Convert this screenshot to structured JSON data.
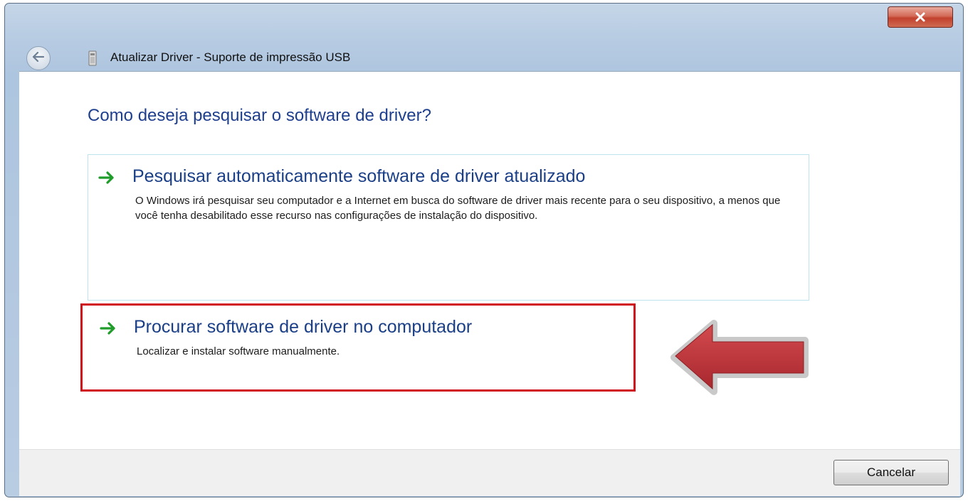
{
  "window": {
    "title": "Atualizar Driver - Suporte de impressão USB",
    "close_icon": "close-icon",
    "back_icon": "back-arrow-icon",
    "app_icon": "printer-device-icon"
  },
  "main": {
    "heading": "Como deseja pesquisar o software de driver?",
    "options": [
      {
        "title": "Pesquisar automaticamente software de driver atualizado",
        "description": "O Windows irá pesquisar seu computador e a Internet em busca do software de driver mais recente para o seu dispositivo, a menos que você tenha desabilitado esse recurso nas configurações de instalação do dispositivo.",
        "icon": "green-arrow-icon"
      },
      {
        "title": "Procurar software de driver no computador",
        "description": "Localizar e instalar software manualmente.",
        "icon": "green-arrow-icon",
        "highlight_color": "#d0111b"
      }
    ],
    "annotation_icon": "red-pointer-arrow-icon"
  },
  "footer": {
    "cancel_label": "Cancelar"
  },
  "colors": {
    "heading": "#1e3e8e",
    "option_title": "#1a3f87",
    "accent_green": "#1f9c2a",
    "highlight_red": "#d0111b",
    "annotation_arrow": "#c0393e"
  }
}
